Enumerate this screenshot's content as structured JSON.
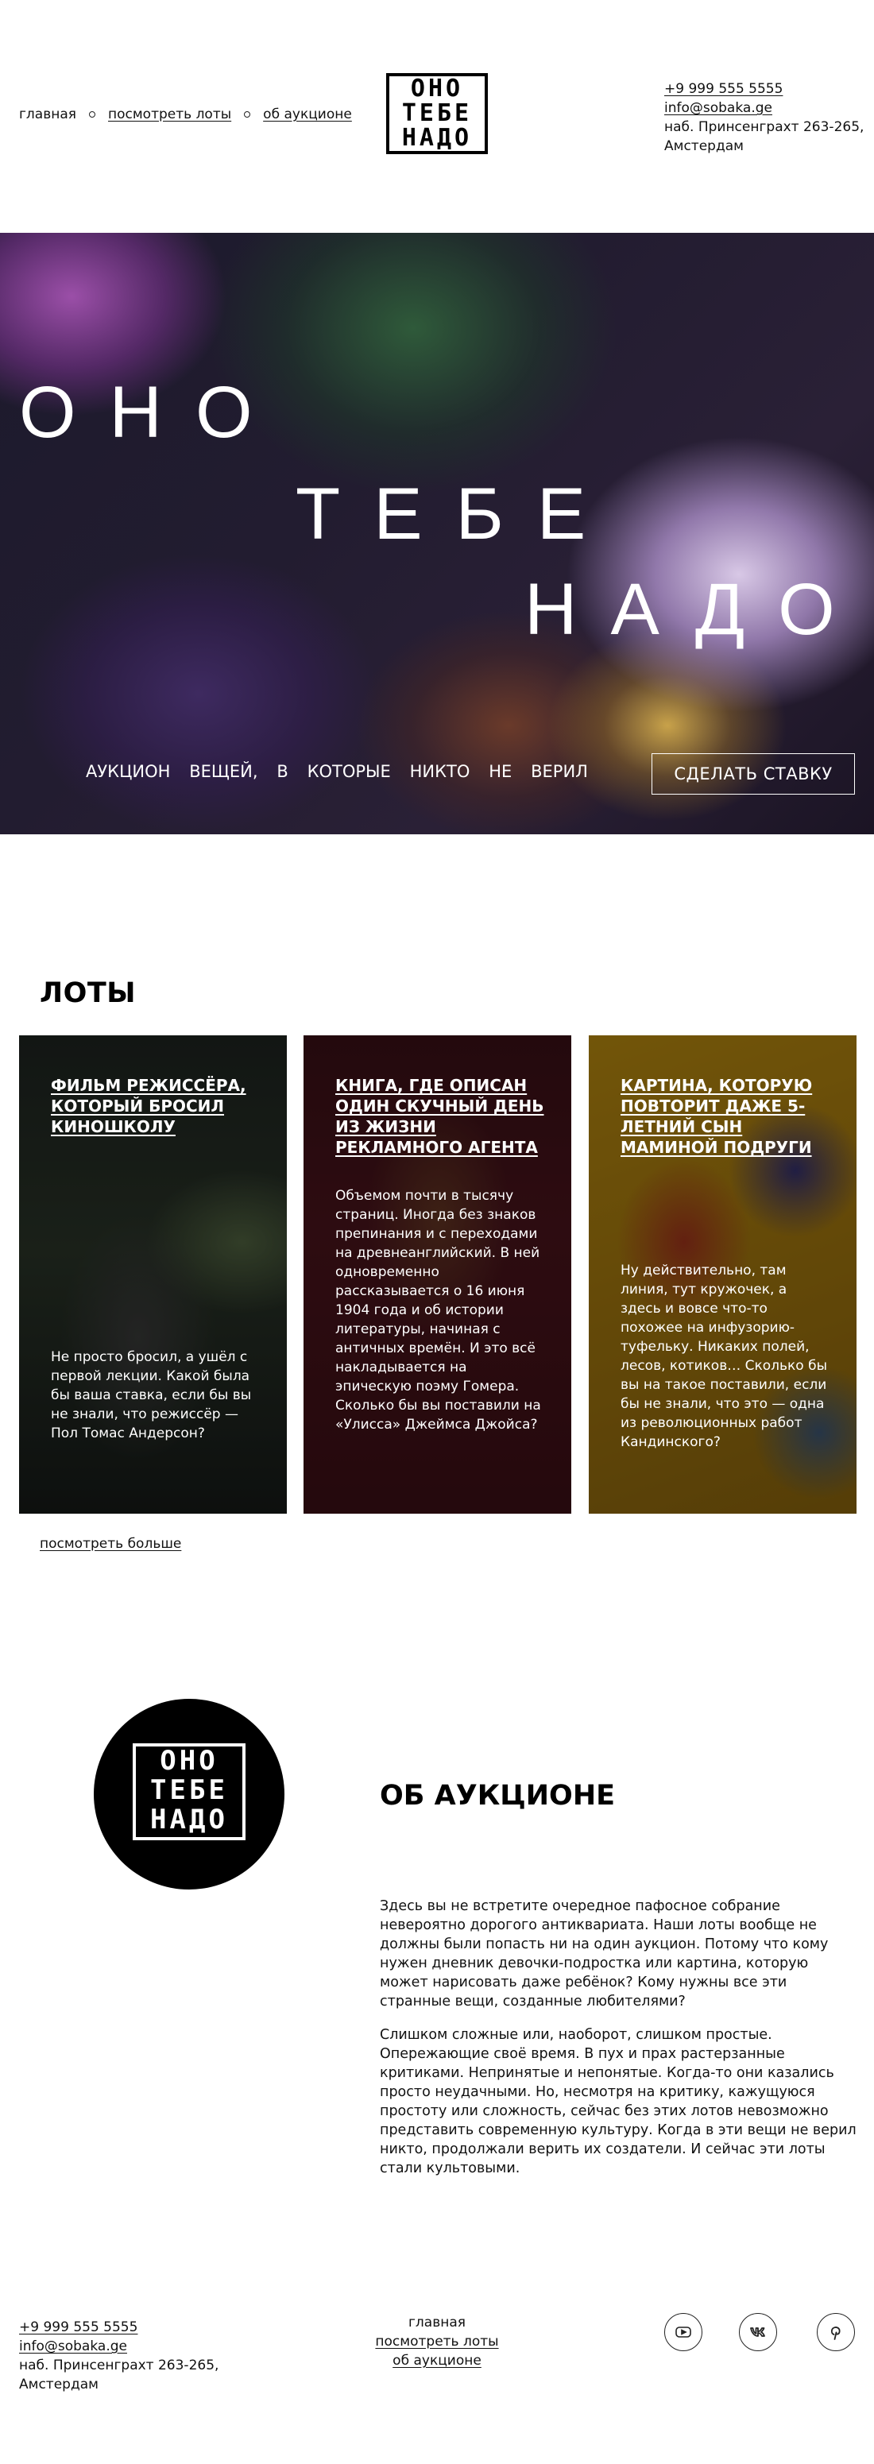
{
  "header": {
    "nav": [
      {
        "label": "главная",
        "active": true
      },
      {
        "label": "посмотреть лоты"
      },
      {
        "label": "об аукционе"
      }
    ],
    "logo_lines": [
      "ОНО",
      "ТЕБЕ",
      "НАДО"
    ],
    "contacts": {
      "phone": "+9 999 555 5555",
      "email": "info@sobaka.ge",
      "address_line1": "наб. Принсенграхт 263-265,",
      "address_line2": "Амстердам"
    }
  },
  "hero": {
    "words": [
      "ОНО",
      "ТЕБЕ",
      "НАДО"
    ],
    "tagline": [
      "АУКЦИОН",
      "ВЕЩЕЙ,",
      "В",
      "КОТОРЫЕ",
      "НИКТО",
      "НЕ",
      "ВЕРИЛ"
    ],
    "cta_label": "СДЕЛАТЬ СТАВКУ"
  },
  "lots": {
    "title": "ЛОТЫ",
    "cards": [
      {
        "title": "ФИЛЬМ РЕЖИССЁРА, КОТОРЫЙ БРОСИЛ КИНОШКОЛУ",
        "text": "Не просто бросил, а ушёл с первой лекции. Какой была бы ваша ставка, если бы вы не знали, что режиссёр — Пол Томас Андерсон?"
      },
      {
        "title": "КНИГА, ГДЕ ОПИСАН ОДИН СКУЧНЫЙ ДЕНЬ ИЗ ЖИЗНИ РЕКЛАМНОГО АГЕНТА",
        "text": "Объемом почти в тысячу страниц. Иногда без знаков препинания и с переходами на древнеанглийский. В ней одновременно рассказывается о 16 июня 1904 года и об истории литературы, начиная с античных времён. И это всё накладывается на эпическую поэму Гомера. Сколько бы вы поставили на «Улисса» Джеймса Джойса?"
      },
      {
        "title": "КАРТИНА, КОТОРУЮ ПОВТОРИТ ДАЖЕ 5-ЛЕТНИЙ СЫН МАМИНОЙ ПОДРУГИ",
        "text": "Ну действительно, там линия, тут кружочек, а здесь и вовсе что-то похожее на инфузорию-туфельку. Никаких полей, лесов, котиков… Сколько бы вы на такое поставили, если бы не знали, что это — одна из революционных работ Кандинского?"
      }
    ],
    "more_label": "посмотреть больше"
  },
  "about": {
    "logo_lines": [
      "ОНО",
      "ТЕБЕ",
      "НАДО"
    ],
    "title": "ОБ АУКЦИОНЕ",
    "p1": "Здесь вы не встретите очередное пафосное собрание невероятно дорогого антиквариата. Наши лоты вообще не должны были попасть ни на один аукцион. Потому что кому нужен дневник девочки-подростка или картина, которую может нарисовать даже ребёнок? Кому нужны все эти странные вещи, созданные любителями?",
    "p2": "Слишком сложные или, наоборот, слишком простые. Опережающие своё время. В пух и прах растерзанные критиками. Непринятые и непонятые. Когда-то они казались просто неудачными. Но, несмотря на критику, кажущуюся простоту или сложность, сейчас без этих лотов невозможно представить современную культуру. Когда в эти вещи не верил никто, продолжали верить их создатели. И сейчас эти лоты стали культовыми."
  },
  "footer": {
    "phone": "+9 999 555 5555",
    "email": "info@sobaka.ge",
    "address_line1": "наб. Принсенграхт 263-265,",
    "address_line2": "Амстердам",
    "nav": [
      "главная",
      "посмотреть лоты",
      "об аукционе"
    ],
    "social_icons": [
      "youtube-icon",
      "vk-icon",
      "pinterest-icon"
    ]
  }
}
